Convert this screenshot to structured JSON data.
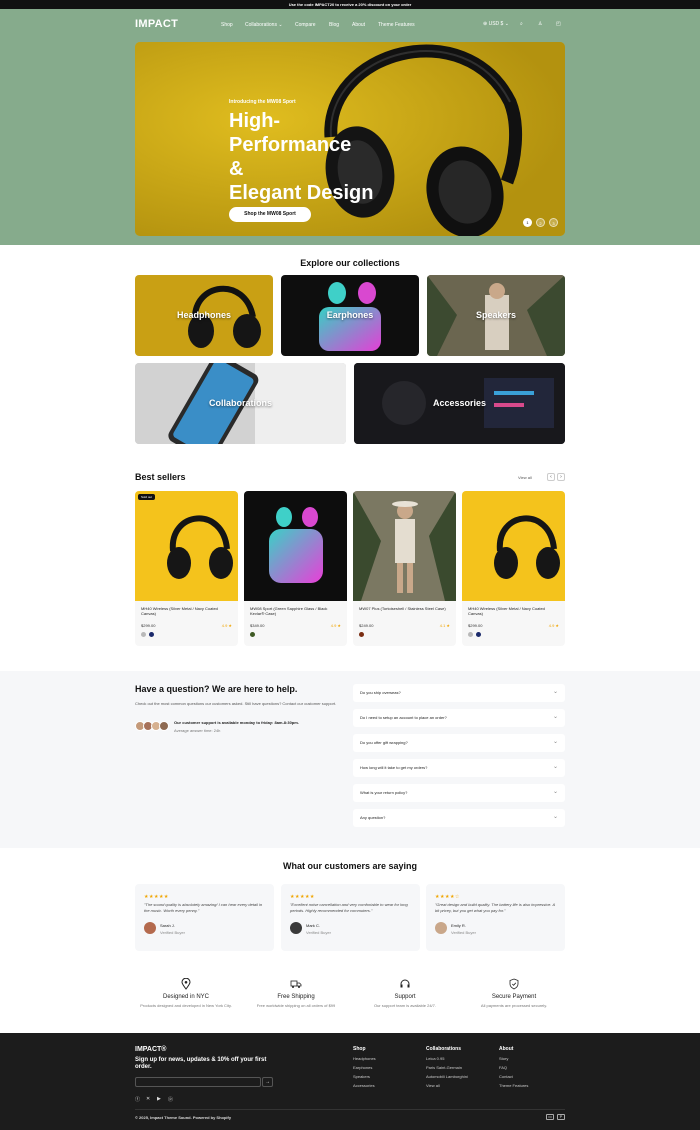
{
  "announcement": "Use the code IMPACT20 to receive a 20% discount on your order",
  "header": {
    "logo": "IMPACT",
    "nav": [
      "Shop",
      "Collaborations",
      "Compare",
      "Blog",
      "About",
      "Theme Features"
    ],
    "currency": "USD $"
  },
  "hero": {
    "kicker": "Introducing the MW08 Sport",
    "title": "High-\nPerformance\n&\nElegant Design",
    "button": "Shop the MW08 Sport",
    "slides": [
      "1",
      "2",
      "3"
    ]
  },
  "collections": {
    "title": "Explore our collections",
    "items": [
      "Headphones",
      "Earphones",
      "Speakers",
      "Collaborations",
      "Accessories"
    ]
  },
  "bestsellers": {
    "title": "Best sellers",
    "view_all": "View all",
    "products": [
      {
        "badge": "Sold out",
        "name": "MH40 Wireless (Silver Metal / Navy Coated Canvas)",
        "price": "$299.00",
        "rating": "4.9 ★",
        "swatches": [
          "#b9b9b9",
          "#1b2a6b"
        ]
      },
      {
        "badge": "",
        "name": "MW08 Sport (Green Sapphire Glass / Black Kevlar® Case)",
        "price": "$349.00",
        "rating": "4.9 ★",
        "swatches": [
          "#3f5a24"
        ]
      },
      {
        "badge": "",
        "name": "MW07 Plus (Tortoiseshell / Stainless Steel Case)",
        "price": "$249.00",
        "rating": "4.1 ★",
        "swatches": [
          "#7a2d12"
        ]
      },
      {
        "badge": "",
        "name": "MH40 Wireless (Silver Metal / Navy Coated Canvas)",
        "price": "$299.00",
        "rating": "4.9 ★",
        "swatches": [
          "#b9b9b9",
          "#1b2a6b"
        ]
      }
    ]
  },
  "faq": {
    "title": "Have a question? We are here to help.",
    "description": "Check out the most common questions our customers asked. Still have questions? Contact our customer support.",
    "support": "Our customer support is available monday to friday: 8am-8:30pm.",
    "average": "Average answer time: 24h",
    "questions": [
      "Do you ship overseas?",
      "Do I need to setup an account to place an order?",
      "Do you offer gift wrapping?",
      "How long will it take to get my orders?",
      "What is your return policy?",
      "Any question?"
    ]
  },
  "testimonials": {
    "title": "What our customers are saying",
    "items": [
      {
        "stars": "★★★★★",
        "text": "\"The sound quality is absolutely amazing! I can hear every detail in the music. Worth every penny.\"",
        "name": "Sarah J.",
        "verified": "Verified Buyer"
      },
      {
        "stars": "★★★★★",
        "text": "\"Excellent noise cancellation and very comfortable to wear for long periods. Highly recommended for commuters.\"",
        "name": "Mark C.",
        "verified": "Verified Buyer"
      },
      {
        "stars": "★★★★☆",
        "text": "\"Great design and build quality. The battery life is also impressive. A bit pricey, but you get what you pay for.\"",
        "name": "Emily R.",
        "verified": "Verified Buyer"
      }
    ]
  },
  "features": [
    {
      "icon": "map-pin-icon",
      "title": "Designed in NYC",
      "desc": "Products designed and developed in New York City."
    },
    {
      "icon": "truck-icon",
      "title": "Free Shipping",
      "desc": "Free worldwide shipping on all orders of $99"
    },
    {
      "icon": "headset-icon",
      "title": "Support",
      "desc": "Our support team is available 24/7."
    },
    {
      "icon": "shield-icon",
      "title": "Secure Payment",
      "desc": "All payments are processed securely."
    }
  ],
  "footer": {
    "logo": "IMPACT®",
    "signup": "Sign up for news, updates & 10% off your first order.",
    "columns": [
      {
        "title": "Shop",
        "links": [
          "Headphones",
          "Earphones",
          "Speakers",
          "Accessories"
        ]
      },
      {
        "title": "Collaborations",
        "links": [
          "Leica 0.95",
          "Paris Saint-Germain",
          "Automobili Lamborghini",
          "View all"
        ]
      },
      {
        "title": "About",
        "links": [
          "Story",
          "FAQ",
          "Contact",
          "Theme Features"
        ]
      }
    ],
    "copyright": "© 2025, Impact Theme Sound. Powered by Shopify"
  },
  "colors": {
    "hero_bg": "#86ab8c",
    "hero_yellow": "#d0ab15",
    "star": "#f0a500",
    "footer_bg": "#1c1c1c"
  }
}
